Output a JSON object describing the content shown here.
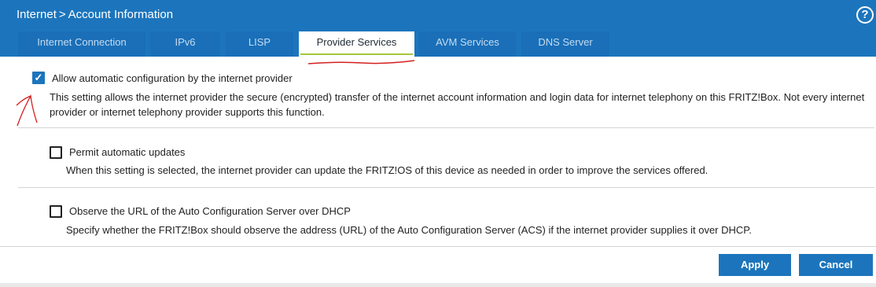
{
  "header": {
    "breadcrumb": {
      "section": "Internet",
      "separator": ">",
      "page": "Account Information"
    },
    "help_icon": "question-circle-icon"
  },
  "tabs": [
    {
      "label": "Internet Connection",
      "active": false
    },
    {
      "label": "IPv6",
      "active": false
    },
    {
      "label": "LISP",
      "active": false
    },
    {
      "label": "Provider Services",
      "active": true
    },
    {
      "label": "AVM Services",
      "active": false
    },
    {
      "label": "DNS Server",
      "active": false
    }
  ],
  "settings": {
    "auto_config": {
      "label": "Allow automatic configuration by the internet provider",
      "checked": true,
      "description": "This setting allows the internet provider the secure (encrypted) transfer of the internet account information and login data for internet telephony on this FRITZ!Box. Not every internet provider or internet telephony provider supports this function."
    },
    "auto_updates": {
      "label": "Permit automatic updates",
      "checked": false,
      "description": "When this setting is selected, the internet provider can update the FRITZ!OS of this device as needed in order to improve the services offered."
    },
    "observe_acs": {
      "label": "Observe the URL of the Auto Configuration Server over DHCP",
      "checked": false,
      "description": "Specify whether the FRITZ!Box should observe the address (URL) of the Auto Configuration Server (ACS) if the internet provider supplies it over DHCP."
    }
  },
  "buttons": {
    "apply": "Apply",
    "cancel": "Cancel"
  },
  "colors": {
    "primary": "#1c75bc",
    "tab_bg": "#1a6fb8",
    "annotation": "#d42020",
    "active_underline": "#a5c63b"
  }
}
